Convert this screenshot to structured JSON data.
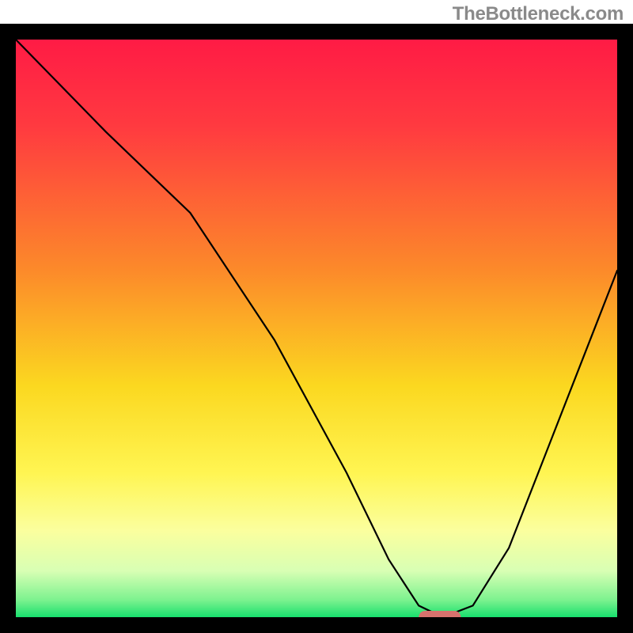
{
  "watermark": {
    "text": "TheBottleneck.com"
  },
  "chart_data": {
    "type": "line",
    "title": "",
    "xlabel": "",
    "ylabel": "",
    "xlim": [
      0,
      100
    ],
    "ylim": [
      0,
      100
    ],
    "grid": false,
    "series": [
      {
        "name": "bottleneck-curve",
        "x": [
          0,
          15,
          29,
          43,
          55,
          62,
          67,
          71,
          76,
          82,
          88,
          94,
          100
        ],
        "values": [
          100,
          84,
          70,
          48,
          25,
          10,
          2,
          0,
          2,
          12,
          28,
          44,
          60
        ]
      }
    ],
    "marker": {
      "x_start": 67,
      "x_end": 74,
      "y": 0
    },
    "gradient_stops": [
      {
        "pos": 0.0,
        "color": "#ff1b45"
      },
      {
        "pos": 0.15,
        "color": "#ff3a40"
      },
      {
        "pos": 0.4,
        "color": "#fc8a2a"
      },
      {
        "pos": 0.6,
        "color": "#fbd820"
      },
      {
        "pos": 0.75,
        "color": "#fff552"
      },
      {
        "pos": 0.85,
        "color": "#fbff9e"
      },
      {
        "pos": 0.92,
        "color": "#d8ffb4"
      },
      {
        "pos": 0.97,
        "color": "#7df28f"
      },
      {
        "pos": 1.0,
        "color": "#18e06e"
      }
    ],
    "frame_color": "#000000",
    "frame_thickness_px": 20,
    "marker_color": "#d6726d"
  }
}
